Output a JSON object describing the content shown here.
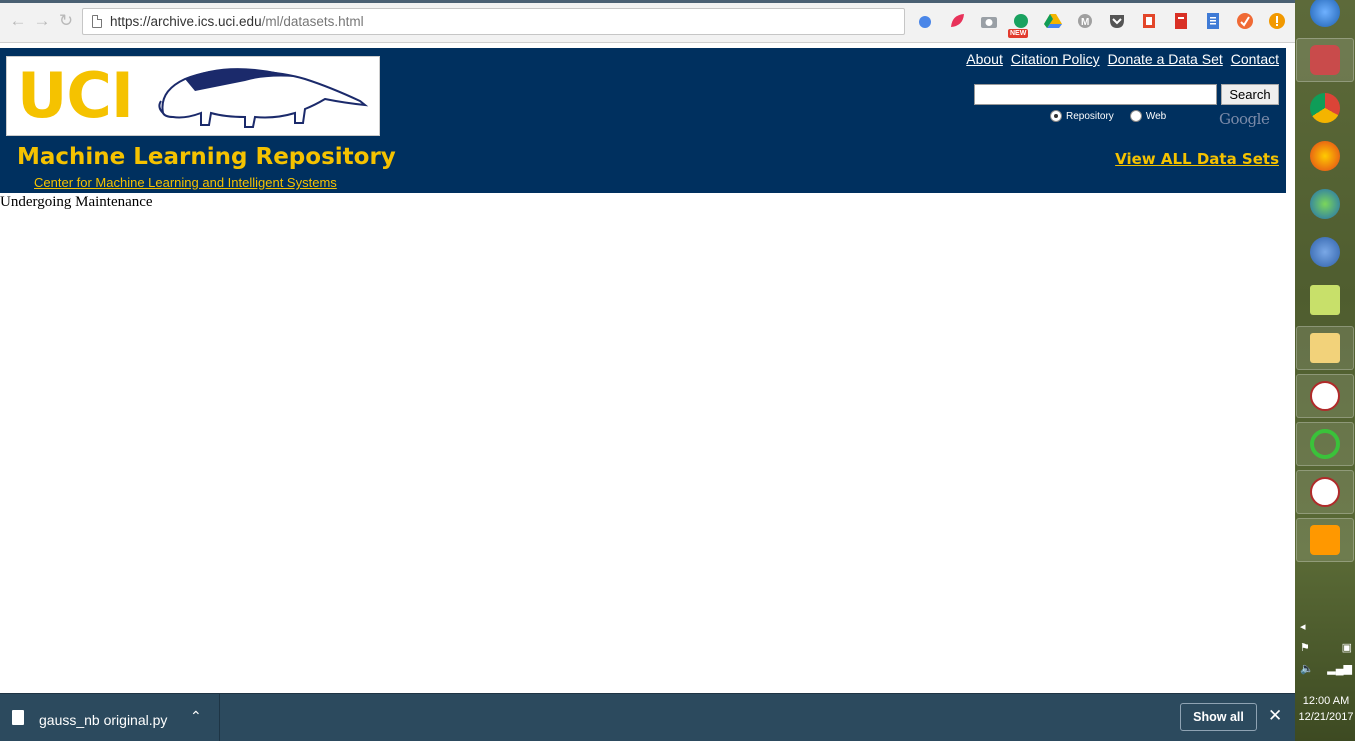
{
  "browser": {
    "url_host": "https://archive.ics.uci.edu",
    "url_path": "/ml/datasets.html",
    "extensions": [
      "drive-icon",
      "leaf-icon",
      "camera-icon",
      "new-extension-icon",
      "google-drive-icon",
      "m-icon",
      "pocket-icon",
      "office-icon",
      "pdf-icon",
      "docs-icon",
      "tick-icon",
      "alert-icon"
    ],
    "new_badge": "NEW"
  },
  "site": {
    "logo_text": "UCI",
    "title": "Machine Learning Repository",
    "subtitle": "Center for Machine Learning and Intelligent Systems",
    "nav_links": [
      "About",
      "Citation Policy",
      "Donate a Data Set",
      "Contact"
    ],
    "search": {
      "button_label": "Search",
      "value": ""
    },
    "search_scope": [
      {
        "label": "Repository",
        "checked": true
      },
      {
        "label": "Web",
        "checked": false
      }
    ],
    "google_label": "Google",
    "view_all_label": "View ALL Data Sets",
    "body_message": "Undergoing Maintenance"
  },
  "downloads": {
    "file_name": "gauss_nb original.py",
    "show_all_label": "Show all"
  },
  "taskbar": {
    "time": "12:00 AM",
    "date": "12/21/2017"
  },
  "colors": {
    "header_bg": "#00305f",
    "accent_gold": "#f5c200",
    "download_bar": "#2c4a5e"
  }
}
